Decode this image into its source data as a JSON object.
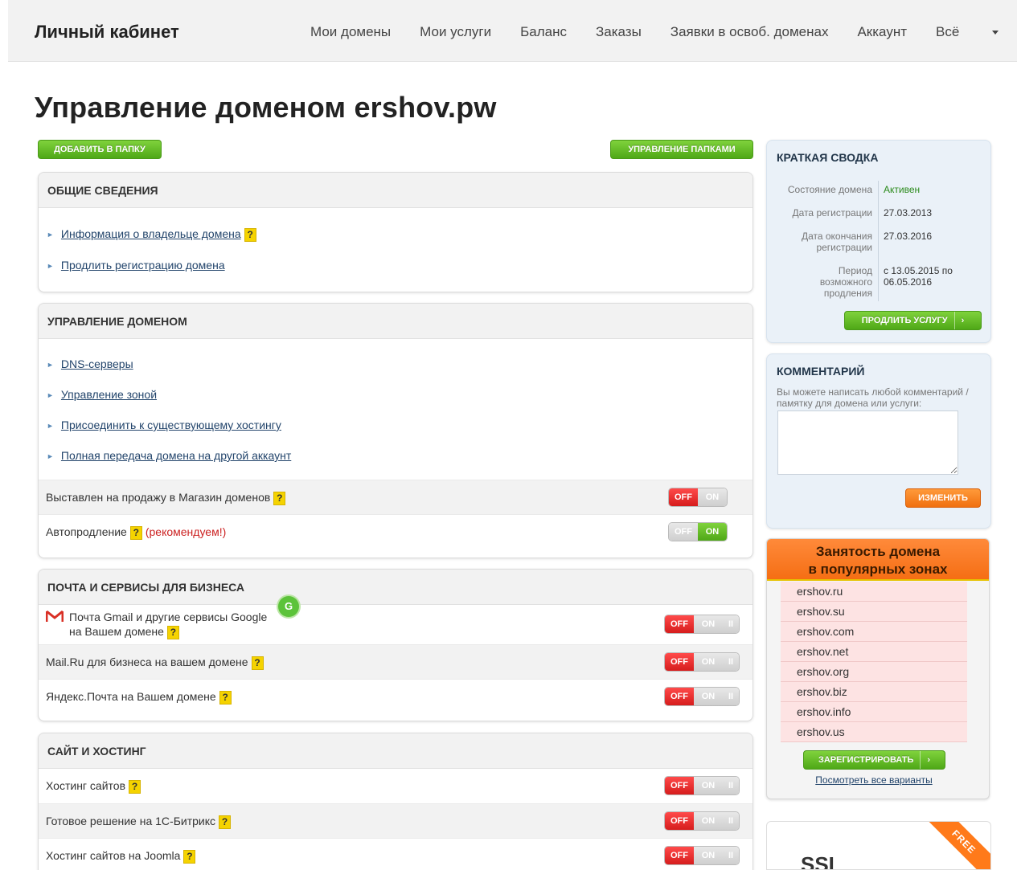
{
  "nav": {
    "brand": "Личный кабинет",
    "items": [
      "Мои домены",
      "Мои услуги",
      "Баланс",
      "Заказы",
      "Заявки в освоб. доменах",
      "Аккаунт",
      "Всё"
    ]
  },
  "page_title": "Управление доменом ershov.pw",
  "buttons": {
    "add_to_folder": "ДОБАВИТЬ В ПАПКУ",
    "manage_folders": "УПРАВЛЕНИЕ ПАПКАМИ",
    "renew_service": "ПРОДЛИТЬ УСЛУГУ",
    "change": "ИЗМЕНИТЬ",
    "register": "ЗАРЕГИСТРИРОВАТЬ",
    "arrow": "›"
  },
  "general": {
    "title": "ОБЩИЕ СВЕДЕНИЯ",
    "links": [
      "Информация о владельце домена",
      "Продлить регистрацию домена"
    ]
  },
  "domain_mgmt": {
    "title": "УПРАВЛЕНИЕ ДОМЕНОМ",
    "links": [
      "DNS-серверы",
      "Управление зоной",
      "Присоединить к существующему хостингу",
      "Полная передача домена на другой аккаунт"
    ],
    "for_sale": "Выставлен на продажу в Магазин доменов",
    "autorenew": "Автопродление",
    "recommended": "(рекомендуем!)"
  },
  "mail": {
    "title": "ПОЧТА И СЕРВИСЫ ДЛЯ БИЗНЕСА",
    "gmail_line1": "Почта Gmail и другие сервисы Google",
    "gmail_line2": "на Вашем домене",
    "mailru": "Mail.Ru для бизнеса на вашем домене",
    "yandex": "Яндекс.Почта на Вашем домене"
  },
  "hosting": {
    "title": "САЙТ И ХОСТИНГ",
    "items": [
      "Хостинг сайтов",
      "Готовое решение на 1С-Битрикс",
      "Хостинг сайтов на Joomla"
    ]
  },
  "toggles": {
    "off": "OFF",
    "on": "ON",
    "bars": "II",
    "for_sale_state": "off",
    "autorenew_state": "on"
  },
  "help_mark": "?",
  "summary": {
    "title": "КРАТКАЯ СВОДКА",
    "status_label": "Состояние домена",
    "status_value": "Активен",
    "reg_label": "Дата регистрации",
    "reg_value": "27.03.2013",
    "exp_label": "Дата окончания регистрации",
    "exp_value": "27.03.2016",
    "period_label": "Период возможного продления",
    "period_value": "с 13.05.2015 по 06.05.2016"
  },
  "comment": {
    "title": "КОММЕНТАРИЙ",
    "hint": "Вы можете написать любой комментарий / памятку для домена или услуги:",
    "value": ""
  },
  "availability": {
    "title_line1": "Занятость домена",
    "title_line2": "в популярных зонах",
    "domains": [
      "ershov.ru",
      "ershov.su",
      "ershov.com",
      "ershov.net",
      "ershov.org",
      "ershov.biz",
      "ershov.info",
      "ershov.us"
    ],
    "all_link": "Посмотреть все варианты"
  },
  "ssl": {
    "text": "SSL",
    "ribbon": "FREE"
  },
  "colors": {
    "green": "#5cb82a",
    "orange": "#f07010",
    "red": "#d61d1d",
    "link": "#22446b",
    "sidebar_bg": "#eaf1f8"
  }
}
